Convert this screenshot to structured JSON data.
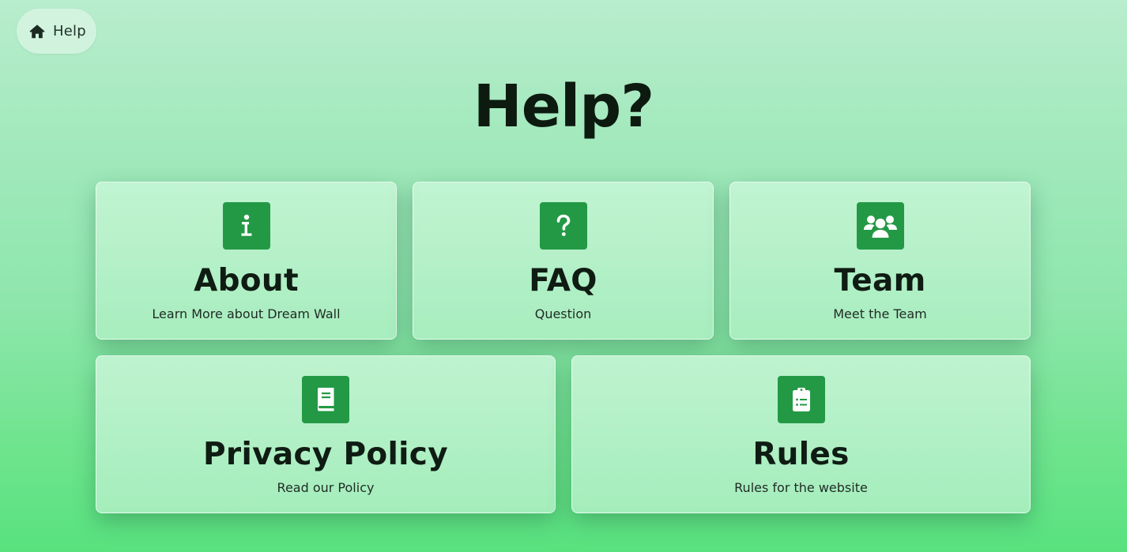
{
  "breadcrumb": {
    "icon": "home-icon",
    "label": "Help"
  },
  "page": {
    "title": "Help?"
  },
  "colors": {
    "icon_tile": "#239945",
    "title_text": "#0d1a10",
    "background_top": "#b8edcd",
    "background_bottom": "#58e27e"
  },
  "cards": [
    {
      "icon": "info-icon",
      "title": "About",
      "subtitle": "Learn More about Dream Wall"
    },
    {
      "icon": "question-icon",
      "title": "FAQ",
      "subtitle": "Question"
    },
    {
      "icon": "users-icon",
      "title": "Team",
      "subtitle": "Meet the Team"
    },
    {
      "icon": "book-icon",
      "title": "Privacy Policy",
      "subtitle": "Read our Policy"
    },
    {
      "icon": "clipboard-list-icon",
      "title": "Rules",
      "subtitle": "Rules for the website"
    }
  ]
}
